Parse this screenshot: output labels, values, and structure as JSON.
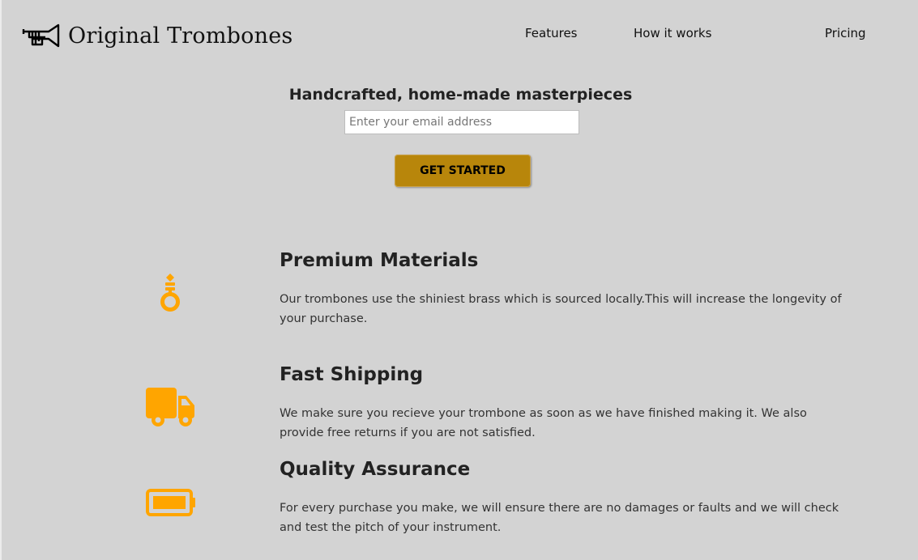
{
  "header": {
    "logo_text": "Original Trombones",
    "logo_icon": "trumpet-icon",
    "nav": [
      {
        "label": "Features"
      },
      {
        "label": "How it works"
      },
      {
        "label": "Pricing"
      }
    ]
  },
  "hero": {
    "title": "Handcrafted, home-made masterpieces",
    "email_placeholder": "Enter your email address",
    "email_value": "",
    "cta_label": "GET STARTED"
  },
  "features": [
    {
      "icon": "medal-icon",
      "title": "Premium Materials",
      "description": "Our trombones use the shiniest brass which is sourced locally.This will increase the longevity of your purchase."
    },
    {
      "icon": "truck-icon",
      "title": "Fast Shipping",
      "description": "We make sure you recieve your trombone as soon as we have finished making it. We also provide free returns if you are not satisfied."
    },
    {
      "icon": "battery-full-icon",
      "title": "Quality Assurance",
      "description": "For every purchase you make, we will ensure there are no damages or faults and we will check and test the pitch of your instrument."
    }
  ],
  "colors": {
    "background": "#d3d3d3",
    "accent_icon": "#ffa500",
    "button": "#b8860b"
  }
}
